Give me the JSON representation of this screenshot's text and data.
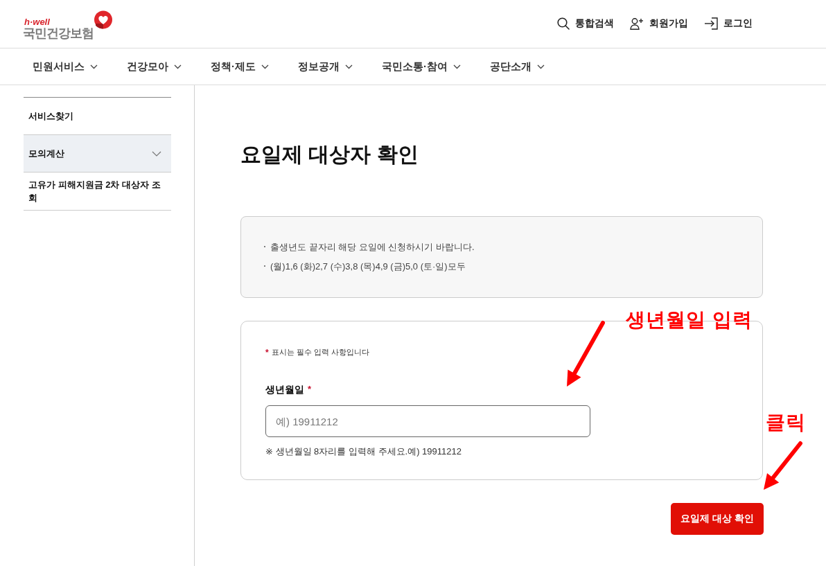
{
  "header": {
    "logo": {
      "tagline": "h·well",
      "name": "국민건강보험"
    },
    "utility_links": [
      {
        "kind": "search",
        "label": "통합검색"
      },
      {
        "kind": "signup",
        "label": "회원가입"
      },
      {
        "kind": "login",
        "label": "로그인"
      }
    ]
  },
  "nav": {
    "items": [
      "민원서비스",
      "건강모아",
      "정책·제도",
      "정보공개",
      "국민소통·참여",
      "공단소개"
    ]
  },
  "sidebar": {
    "items": [
      {
        "label": "서비스찾기",
        "kind": "link",
        "selected": false
      },
      {
        "label": "모의계산",
        "kind": "group",
        "selected": true
      },
      {
        "label": "고유가 피해지원금 2차 대상자 조회",
        "kind": "link",
        "selected": false
      }
    ]
  },
  "page": {
    "title": "요일제 대상자 확인"
  },
  "notice": {
    "items": [
      "출생년도 끝자리 해당 요일에 신청하시기 바랍니다.",
      "(월)1,6 (화)2,7 (수)3,8 (목)4,9 (금)5,0 (토·일)모두"
    ]
  },
  "form": {
    "required_note": {
      "mark": "*",
      "text": "표시는 필수 입력 사항입니다"
    },
    "fields": [
      {
        "label": "생년월일",
        "required_mark": "*",
        "placeholder": "예) 19911212",
        "help": "※ 생년월일 8자리를 입력해 주세요.예) 19911212"
      }
    ],
    "submit_button": {
      "label": "요일제 대상 확인"
    }
  },
  "annotations": [
    {
      "text": "생년월일 입력"
    },
    {
      "text": "클릭"
    }
  ]
}
